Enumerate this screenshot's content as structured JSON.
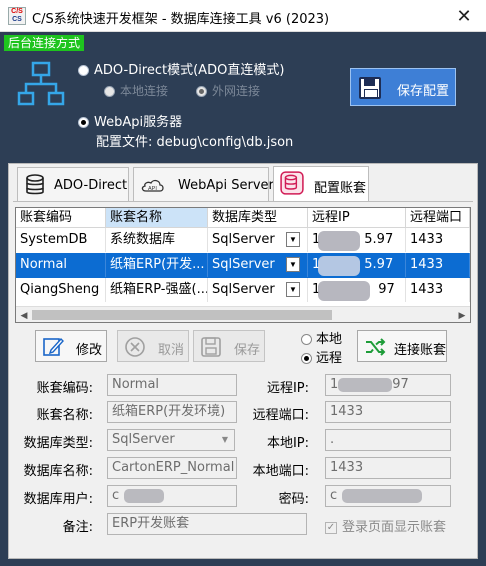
{
  "window": {
    "title": "C/S系统快速开发框架 - 数据库连接工具 v6 (2023)",
    "icon_text_top": "C/S",
    "icon_text_bottom": "CS"
  },
  "top": {
    "mode_badge": "后台连接方式",
    "option_ado": "ADO-Direct模式(ADO直连模式)",
    "option_local": "本地连接",
    "option_external": "外网连接",
    "option_webapi": "WebApi服务器",
    "config_file_label": "配置文件:",
    "config_file_value": "debug\\config\\db.json",
    "save_config_button": "保存配置",
    "selected_mode": "WebApi服务器"
  },
  "tabs": [
    {
      "label": "ADO-Direct",
      "icon": "database-icon",
      "active": false
    },
    {
      "label": "WebApi Server",
      "icon": "cloud-api-icon",
      "active": false
    },
    {
      "label": "配置账套",
      "icon": "database-config-icon",
      "active": true
    }
  ],
  "grid": {
    "columns": [
      "账套编码",
      "账套名称",
      "数据库类型",
      "远程IP",
      "远程端口"
    ],
    "sorted_column": "账套名称",
    "rows": [
      {
        "code": "SystemDB",
        "name": "系统数据库",
        "dbtype": "SqlServer",
        "ip_prefix": "1",
        "ip_suffix": "5.97",
        "port": "1433",
        "selected": false
      },
      {
        "code": "Normal",
        "name": "纸箱ERP(开发...",
        "dbtype": "SqlServer",
        "ip_prefix": "1",
        "ip_suffix": "5.97",
        "port": "1433",
        "selected": true
      },
      {
        "code": "QiangSheng",
        "name": "纸箱ERP-强盛(...",
        "dbtype": "SqlServer",
        "ip_prefix": "1",
        "ip_suffix": "97",
        "port": "1433",
        "selected": false
      }
    ]
  },
  "actions": {
    "edit": "修改",
    "cancel": "取消",
    "save": "保存",
    "local": "本地",
    "remote": "远程",
    "selected_location": "远程",
    "connect": "连接账套"
  },
  "form": {
    "code_label": "账套编码:",
    "code_value": "Normal",
    "name_label": "账套名称:",
    "name_value": "纸箱ERP(开发环境)",
    "dbtype_label": "数据库类型:",
    "dbtype_value": "SqlServer",
    "dbname_label": "数据库名称:",
    "dbname_value": "CartonERP_Normal",
    "dbuser_label": "数据库用户:",
    "dbuser_value": "c",
    "remark_label": "备注:",
    "remark_value": "ERP开发账套",
    "remote_ip_label": "远程IP:",
    "remote_ip_value": "1",
    "remote_ip_tail": "97",
    "remote_port_label": "远程端口:",
    "remote_port_value": "1433",
    "local_ip_label": "本地IP:",
    "local_ip_value": ".",
    "local_port_label": "本地端口:",
    "local_port_value": "1433",
    "password_label": "密码:",
    "password_value": "c",
    "show_account_label": "登录页面显示账套",
    "show_account_checked": true
  },
  "colors": {
    "window_bg": "#2d3e55",
    "badge_green": "#1ec41e",
    "accent_blue": "#3e7fd6",
    "row_selected": "#0c6cd2"
  }
}
